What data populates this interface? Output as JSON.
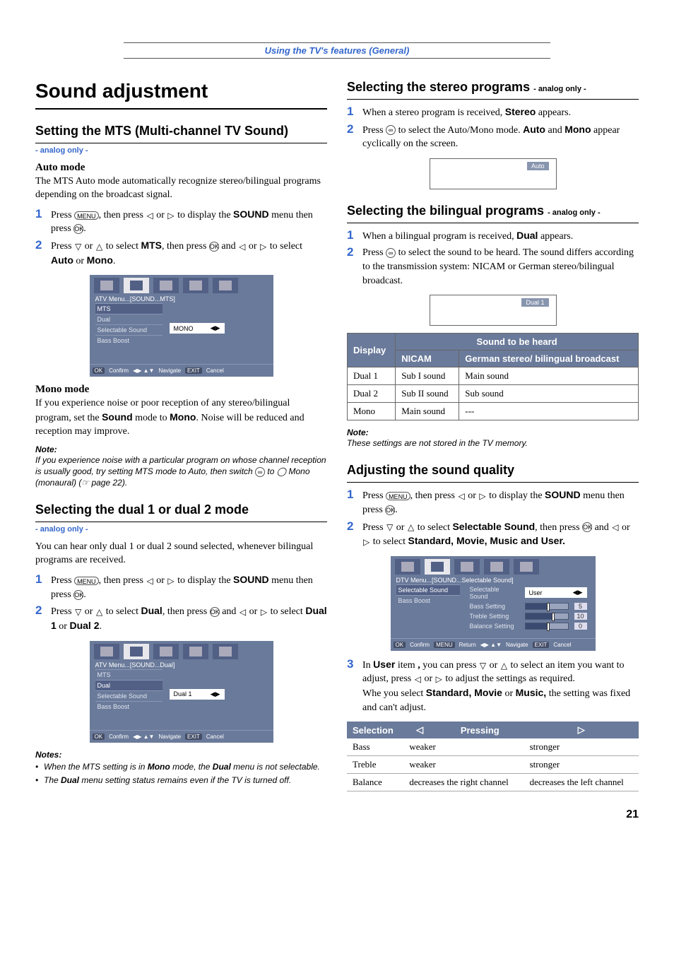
{
  "header": {
    "title": "Using the TV's features (General)"
  },
  "left": {
    "h1": "Sound adjustment",
    "mts": {
      "heading": "Setting the MTS (Multi-channel TV Sound)",
      "tag": "- analog only -",
      "auto_head": "Auto mode",
      "auto_body": "The MTS Auto mode automatically recognize stereo/bilingual programs depending on the broadcast signal.",
      "steps": [
        "Press MENU, then press ◁ or ▷ to display the SOUND menu then press OK.",
        "Press ▽ or △ to select MTS, then press OK and ◁ or ▷ to select Auto or Mono."
      ],
      "menu": {
        "path": "ATV Menu...[SOUND...MTS]",
        "items": [
          "MTS",
          "Dual",
          "Selectable Sound",
          "Bass Boost"
        ],
        "selected": "MTS",
        "value": "MONO",
        "foot": [
          "OK",
          "Confirm",
          "◀▶ ▲▼",
          "Navigate",
          "EXIT",
          "Cancel"
        ]
      },
      "mono_head": "Mono mode",
      "mono_body": "If you experience noise or poor reception of any stereo/bilingual program, set the Sound mode to Mono. Noise will be reduced and reception may improve.",
      "note_h": "Note:",
      "note_b": "If you experience noise with a particular program on whose channel reception is usually good, try setting MTS mode to Auto, then switch ∞ to ◯ Mono (monaural) (☞ page 22)."
    },
    "dual": {
      "heading": "Selecting the dual 1 or dual 2 mode",
      "tag": "- analog only -",
      "intro": "You can hear only dual 1 or dual 2 sound selected, whenever bilingual programs are received.",
      "steps": [
        "Press MENU, then press ◁ or ▷ to display the SOUND menu then press OK.",
        "Press ▽ or △ to select Dual, then press OK and ◁ or ▷ to select Dual 1 or Dual 2."
      ],
      "menu": {
        "path": "ATV Menu...[SOUND...Dual]",
        "items": [
          "MTS",
          "Dual",
          "Selectable Sound",
          "Bass Boost"
        ],
        "selected": "Dual",
        "value": "Dual 1",
        "foot": [
          "OK",
          "Confirm",
          "◀▶ ▲▼",
          "Navigate",
          "EXIT",
          "Cancel"
        ]
      },
      "notes_h": "Notes:",
      "notes": [
        "When the MTS setting is in Mono mode, the Dual menu is not selectable.",
        "The Dual menu setting status remains even if the TV is turned off."
      ]
    }
  },
  "right": {
    "stereo": {
      "heading": "Selecting the stereo programs",
      "tag": "- analog only -",
      "steps": [
        "When a stereo program is received, Stereo appears.",
        "Press ∞ to select the Auto/Mono mode. Auto and Mono appear cyclically on the screen."
      ],
      "osd": "Auto"
    },
    "bilingual": {
      "heading": "Selecting the bilingual programs",
      "tag": "- analog only -",
      "steps": [
        "When a bilingual program is received, Dual appears.",
        "Press ∞ to select the sound to be heard. The sound differs according to the transmission system: NICAM or German stereo/bilingual broadcast."
      ],
      "osd": "Dual 1",
      "table": {
        "head_display": "Display",
        "head_sound": "Sound to be heard",
        "head_nicam": "NICAM",
        "head_german": "German stereo/ bilingual broadcast",
        "rows": [
          [
            "Dual 1",
            "Sub I sound",
            "Main sound"
          ],
          [
            "Dual 2",
            "Sub II sound",
            "Sub sound"
          ],
          [
            "Mono",
            "Main sound",
            "---"
          ]
        ]
      },
      "note_h": "Note:",
      "note_b": "These settings are not stored in the TV memory."
    },
    "quality": {
      "heading": "Adjusting the sound quality",
      "steps": [
        "Press MENU, then press ◁ or ▷ to display the SOUND menu then press OK.",
        "Press ▽ or △ to select Selectable Sound, then press OK and ◁ or ▷ to select Standard, Movie, Music and User."
      ],
      "menu": {
        "path": "DTV Menu...[SOUND...Selectable Sound]",
        "left_items": [
          "Selectable Sound",
          "Bass Boost"
        ],
        "selected": "Selectable Sound",
        "value_label": "Selectable Sound",
        "value": "User",
        "settings": [
          {
            "label": "Bass Setting",
            "val": "5",
            "pct": 50
          },
          {
            "label": "Treble Setting",
            "val": "10",
            "pct": 62
          },
          {
            "label": "Balance Setting",
            "val": "0",
            "pct": 50
          }
        ],
        "foot": [
          "OK",
          "Confirm",
          "MENU",
          "Return",
          "◀▶ ▲▼",
          "Navigate",
          "EXIT",
          "Cancel"
        ]
      },
      "step3": "In User item , you can press ▽ or △ to select an item you want to adjust, press ◁ or ▷ to adjust the settings as required.",
      "step3b": "Whe you select Standard, Movie or Music, the setting was fixed and can't adjust.",
      "seltable": {
        "h_sel": "Selection",
        "h_press": "Pressing",
        "rows": [
          [
            "Bass",
            "weaker",
            "stronger"
          ],
          [
            "Treble",
            "weaker",
            "stronger"
          ],
          [
            "Balance",
            "decreases the right channel",
            "decreases the left channel"
          ]
        ]
      }
    }
  },
  "page": "21"
}
